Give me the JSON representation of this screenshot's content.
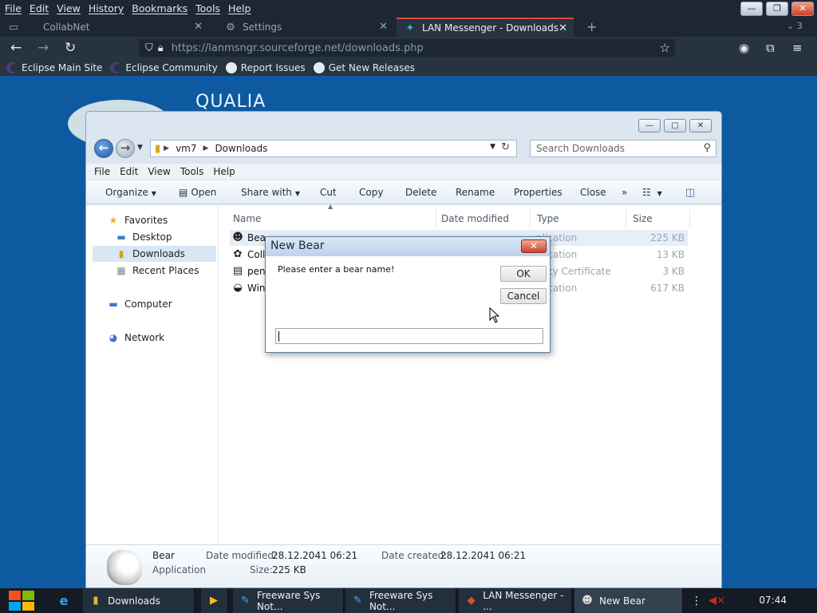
{
  "browser": {
    "menu": [
      "File",
      "Edit",
      "View",
      "History",
      "Bookmarks",
      "Tools",
      "Help"
    ],
    "tabs": [
      {
        "label": "CollabNet"
      },
      {
        "label": "Settings"
      },
      {
        "label": "LAN Messenger - Downloads"
      }
    ],
    "tab_overflow": "3",
    "url_host": "https://lanmsngr.sourceforge.net",
    "url_path": "/downloads.php",
    "bookmarks": [
      "Eclipse Main Site",
      "Eclipse Community",
      "Report Issues",
      "Get New Releases"
    ]
  },
  "webpage": {
    "logo_text": "QUALIA"
  },
  "explorer": {
    "breadcrumb": [
      "vm7",
      "Downloads"
    ],
    "search_placeholder": "Search Downloads",
    "menu": [
      "File",
      "Edit",
      "View",
      "Tools",
      "Help"
    ],
    "toolbar": {
      "organize": "Organize",
      "open": "Open",
      "share_with": "Share with",
      "cut": "Cut",
      "copy": "Copy",
      "delete": "Delete",
      "rename": "Rename",
      "properties": "Properties",
      "close": "Close",
      "more": "»"
    },
    "nav": {
      "favorites": "Favorites",
      "desktop": "Desktop",
      "downloads": "Downloads",
      "recent_places": "Recent Places",
      "computer": "Computer",
      "network": "Network"
    },
    "columns": [
      "Name",
      "Date modified",
      "Type",
      "Size"
    ],
    "files": [
      {
        "name": "Bea",
        "type": "plication",
        "size": "225 KB"
      },
      {
        "name": "Coll",
        "type": "plication",
        "size": "13 KB"
      },
      {
        "name": "pen",
        "type": "urity Certificate",
        "size": "3 KB"
      },
      {
        "name": "Win",
        "type": "plication",
        "size": "617 KB"
      }
    ],
    "details": {
      "name": "Bear",
      "kind": "Application",
      "date_modified_label": "Date modified:",
      "date_modified": "28.12.2041 06:21",
      "date_created_label": "Date created:",
      "date_created": "28.12.2041 06:21",
      "size_label": "Size:",
      "size": "225 KB"
    }
  },
  "dialog": {
    "title": "New Bear",
    "prompt": "Please enter a bear name!",
    "ok": "OK",
    "cancel": "Cancel",
    "input_value": ""
  },
  "taskbar": {
    "items": [
      "Downloads",
      "Freeware Sys Not...",
      "Freeware Sys Not...",
      "LAN Messenger - ...",
      "New Bear"
    ],
    "clock": "07:44"
  },
  "colors": {
    "page_background": "#0e5aa0",
    "browser_chrome": "#1c2733",
    "active_tab_accent": "#e0483a"
  }
}
